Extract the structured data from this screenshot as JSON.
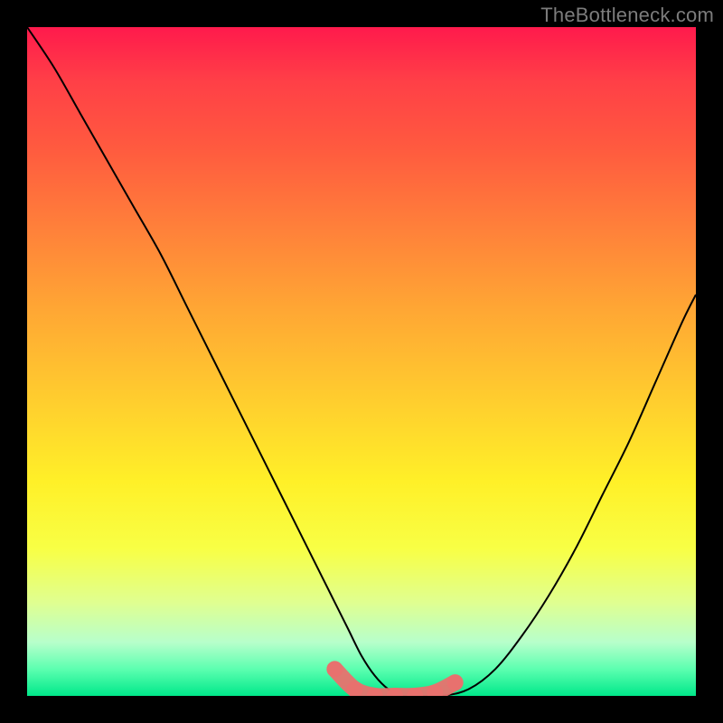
{
  "watermark": "TheBottleneck.com",
  "colors": {
    "frame": "#000000",
    "curve_stroke": "#000000",
    "dot_fill": "#e8716e",
    "gradient_top": "#ff1a4c",
    "gradient_bottom": "#00e88a"
  },
  "chart_data": {
    "type": "line",
    "title": "",
    "xlabel": "",
    "ylabel": "",
    "xlim": [
      0,
      100
    ],
    "ylim": [
      0,
      100
    ],
    "grid": false,
    "series": [
      {
        "name": "bottleneck-curve",
        "x": [
          0,
          4,
          8,
          12,
          16,
          20,
          24,
          28,
          32,
          36,
          40,
          44,
          46,
          48,
          50,
          52,
          54,
          56,
          58,
          62,
          66,
          70,
          74,
          78,
          82,
          86,
          90,
          94,
          98,
          100
        ],
        "y": [
          100,
          94,
          87,
          80,
          73,
          66,
          58,
          50,
          42,
          34,
          26,
          18,
          14,
          10,
          6,
          3,
          1,
          0,
          0,
          0,
          1,
          4,
          9,
          15,
          22,
          30,
          38,
          47,
          56,
          60
        ]
      }
    ],
    "bottom_dots": {
      "name": "optimal-range-dots",
      "x": [
        46,
        49,
        52,
        55,
        58,
        61,
        64
      ],
      "y": [
        4,
        1,
        0,
        0,
        0,
        0.5,
        2
      ]
    }
  }
}
